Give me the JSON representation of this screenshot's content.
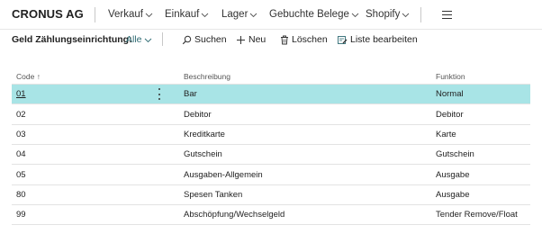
{
  "company": "CRONUS AG",
  "menu": [
    {
      "label": "Verkauf"
    },
    {
      "label": "Einkauf"
    },
    {
      "label": "Lager"
    },
    {
      "label": "Gebuchte Belege"
    },
    {
      "label": "Shopify"
    }
  ],
  "filter": {
    "label": "Geld Zählungseinrichtung:",
    "value": "Alle"
  },
  "actions": {
    "search": "Suchen",
    "new": "Neu",
    "delete": "Löschen",
    "edit_list": "Liste bearbeiten"
  },
  "table": {
    "headers": {
      "code": "Code",
      "code_sort": "↑",
      "description": "Beschreibung",
      "function": "Funktion"
    },
    "rows": [
      {
        "code": "01",
        "description": "Bar",
        "function": "Normal"
      },
      {
        "code": "02",
        "description": "Debitor",
        "function": "Debitor"
      },
      {
        "code": "03",
        "description": "Kreditkarte",
        "function": "Karte"
      },
      {
        "code": "04",
        "description": "Gutschein",
        "function": "Gutschein"
      },
      {
        "code": "05",
        "description": "Ausgaben-Allgemein",
        "function": "Ausgabe"
      },
      {
        "code": "80",
        "description": "Spesen Tanken",
        "function": "Ausgabe"
      },
      {
        "code": "99",
        "description": "Abschöpfung/Wechselgeld",
        "function": "Tender Remove/Float"
      }
    ]
  },
  "colors": {
    "selected_row": "#a8e4e6",
    "filter_value": "#2e6b73"
  }
}
